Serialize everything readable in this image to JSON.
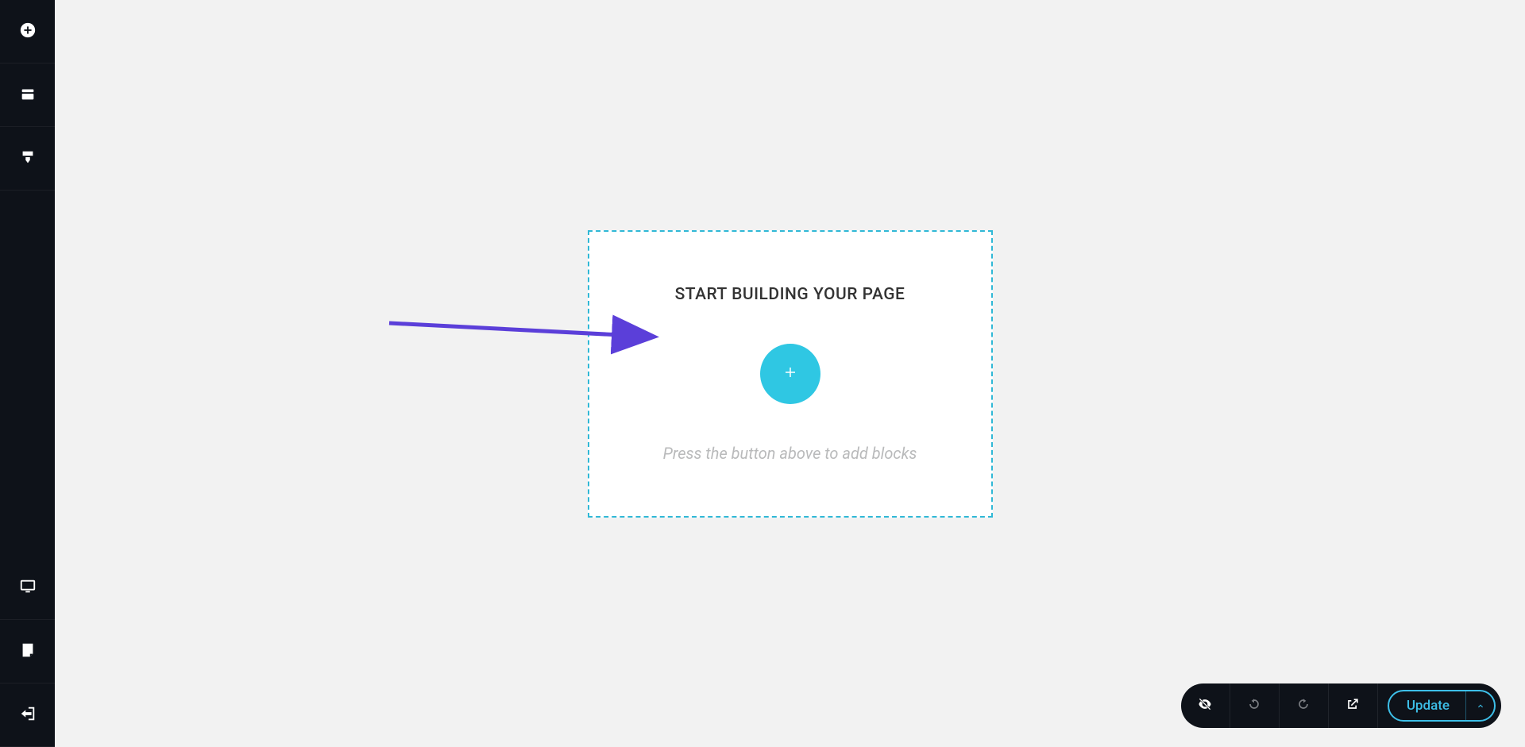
{
  "sidebar": {
    "top_items": [
      {
        "name": "add-element",
        "icon": "plus-circle"
      },
      {
        "name": "reorder-blocks",
        "icon": "layers"
      },
      {
        "name": "styling",
        "icon": "brush"
      }
    ],
    "bottom_items": [
      {
        "name": "desktop-preview",
        "icon": "monitor"
      },
      {
        "name": "page-settings",
        "icon": "note"
      },
      {
        "name": "back-to-dashboard",
        "icon": "exit"
      }
    ]
  },
  "start_card": {
    "title": "START BUILDING YOUR PAGE",
    "hint": "Press the button above to add blocks"
  },
  "toolbar": {
    "hidden_label": "hidden",
    "undo_label": "undo",
    "redo_label": "redo",
    "preview_label": "preview",
    "update_label": "Update"
  },
  "colors": {
    "accent": "#2fc7e3",
    "dashed_border": "#30b8d6",
    "sidebar_bg": "#0e1219",
    "annotation": "#5b3fd9"
  }
}
